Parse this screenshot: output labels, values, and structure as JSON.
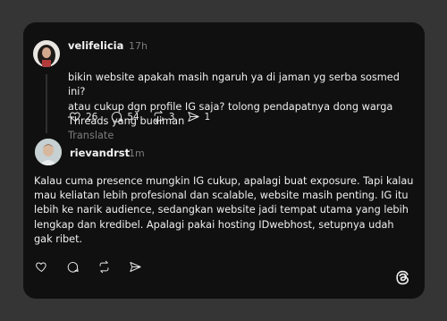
{
  "post1": {
    "username": "velifelicia",
    "time": "17h",
    "text": "bikin website apakah masih ngaruh ya di jaman yg serba sosmed ini?\natau cukup dgn profile IG saja? tolong pendapatnya dong warga\nThreads yang budiman",
    "translate": "Translate",
    "likes": "26",
    "replies": "54",
    "reposts": "3",
    "shares": "1"
  },
  "post2": {
    "username": "rievandrst",
    "time": "1m",
    "text": "Kalau cuma presence mungkin IG cukup, apalagi buat exposure. Tapi kalau\nmau keliatan lebih profesional dan scalable, website masih penting. IG itu\nlebih ke narik audience, sedangkan website jadi tempat utama yang lebih\nlengkap dan kredibel. Apalagi pakai hosting IDwebhost, setupnya udah\ngak ribet."
  },
  "icons": {
    "like": "heart-icon",
    "reply": "comment-icon",
    "repost": "repost-icon",
    "share": "send-icon",
    "brand": "threads-logo-icon"
  }
}
